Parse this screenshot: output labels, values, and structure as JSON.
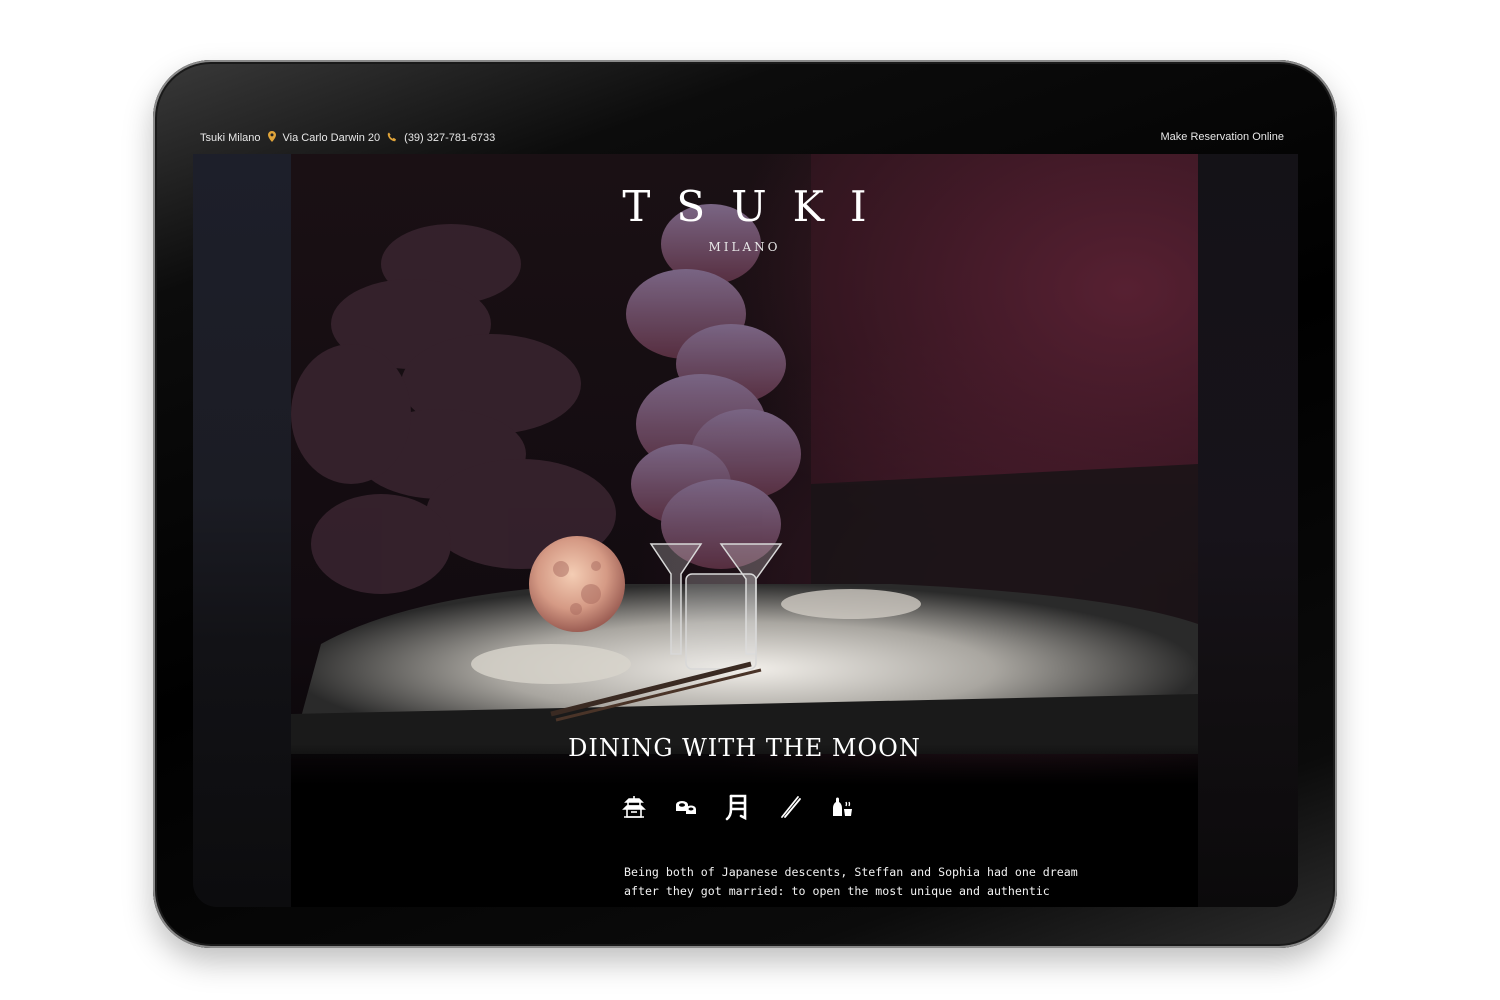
{
  "topbar": {
    "restaurant": "Tsuki Milano",
    "address": "Via Carlo Darwin 20",
    "phone": "(39) 327-781-6733",
    "reservation_link": "Make Reservation Online"
  },
  "hero": {
    "logo": "TSUKI",
    "logo_sub": "MILANO",
    "headline": "DINING WITH THE MOON"
  },
  "icons": [
    "pagoda-icon",
    "sushi-icon",
    "moon-kanji-icon",
    "chopsticks-icon",
    "sake-icon"
  ],
  "intro": {
    "line1": "Being both of Japanese descents, Steffan and Sophia had one dream",
    "line2": "after they got married: to open the most unique and authentic"
  },
  "colors": {
    "accent": "#e0a43a",
    "background": "#000000",
    "text": "#ffffff"
  }
}
